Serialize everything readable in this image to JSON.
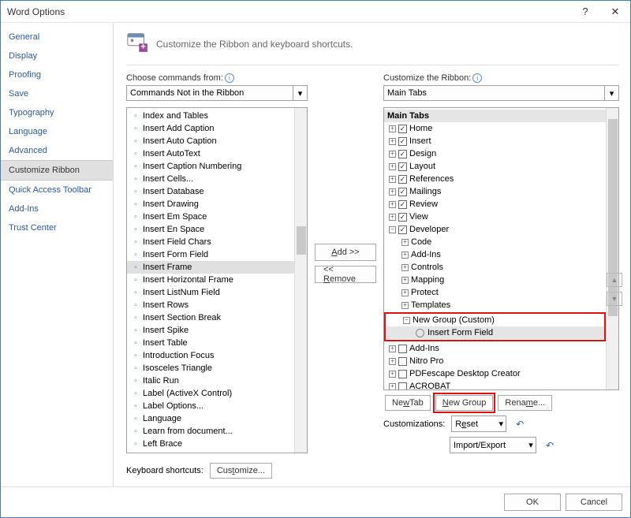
{
  "titlebar": {
    "title": "Word Options",
    "help": "?",
    "close": "✕"
  },
  "sidebar": {
    "items": [
      {
        "label": "General"
      },
      {
        "label": "Display"
      },
      {
        "label": "Proofing"
      },
      {
        "label": "Save"
      },
      {
        "label": "Typography"
      },
      {
        "label": "Language"
      },
      {
        "label": "Advanced"
      },
      {
        "label": "Customize Ribbon",
        "active": true
      },
      {
        "label": "Quick Access Toolbar"
      },
      {
        "label": "Add-Ins"
      },
      {
        "label": "Trust Center"
      }
    ]
  },
  "header": {
    "text": "Customize the Ribbon and keyboard shortcuts."
  },
  "left": {
    "label": "Choose commands from:",
    "combo": "Commands Not in the Ribbon",
    "items": [
      "Index and Tables",
      "Insert Add Caption",
      "Insert Auto Caption",
      "Insert AutoText",
      "Insert Caption Numbering",
      "Insert Cells...",
      "Insert Database",
      "Insert Drawing",
      "Insert Em Space",
      "Insert En Space",
      "Insert Field Chars",
      "Insert Form Field",
      "Insert Frame",
      "Insert Horizontal Frame",
      "Insert ListNum Field",
      "Insert Rows",
      "Insert Section Break",
      "Insert Spike",
      "Insert Table",
      "Introduction Focus",
      "Isosceles Triangle",
      "Italic Run",
      "Label (ActiveX Control)",
      "Label Options...",
      "Language",
      "Learn from document...",
      "Left Brace"
    ],
    "selected": "Insert Frame"
  },
  "mid": {
    "add": "Add >>",
    "remove": "<< Remove"
  },
  "right": {
    "label": "Customize the Ribbon:",
    "combo": "Main Tabs",
    "header": "Main Tabs",
    "tabs": [
      {
        "label": "Home",
        "checked": true
      },
      {
        "label": "Insert",
        "checked": true
      },
      {
        "label": "Design",
        "checked": true
      },
      {
        "label": "Layout",
        "checked": true
      },
      {
        "label": "References",
        "checked": true
      },
      {
        "label": "Mailings",
        "checked": true
      },
      {
        "label": "Review",
        "checked": true
      },
      {
        "label": "View",
        "checked": true
      }
    ],
    "developer": {
      "label": "Developer",
      "checked": true,
      "groups": [
        "Code",
        "Add-Ins",
        "Controls",
        "Mapping",
        "Protect",
        "Templates"
      ]
    },
    "custom": {
      "group": "New Group (Custom)",
      "item": "Insert Form Field"
    },
    "rest": [
      {
        "label": "Add-Ins",
        "checked": false
      },
      {
        "label": "Nitro Pro",
        "checked": false
      },
      {
        "label": "PDFescape Desktop Creator",
        "checked": false
      },
      {
        "label": "ACROBAT",
        "checked": false
      }
    ],
    "buttons": {
      "newtab": "New Tab",
      "newgroup": "New Group",
      "rename": "Rename..."
    },
    "customizations": "Customizations:",
    "reset": "Reset",
    "import": "Import/Export"
  },
  "bottom": {
    "kb": "Keyboard shortcuts:",
    "customize": "Customize..."
  },
  "footer": {
    "ok": "OK",
    "cancel": "Cancel"
  }
}
